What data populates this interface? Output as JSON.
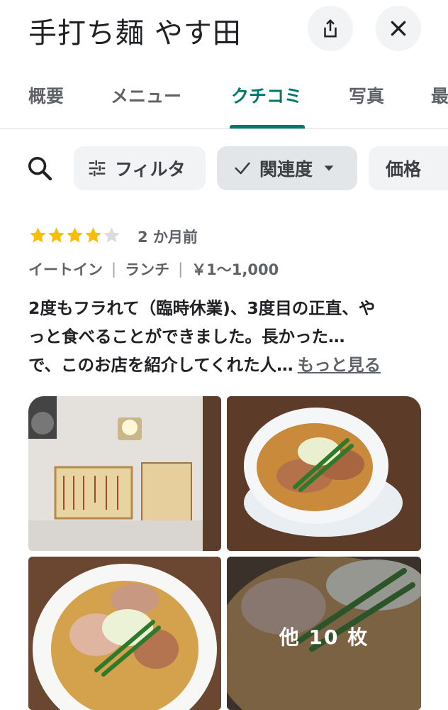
{
  "header": {
    "title": "手打ち麺 やす田",
    "share_icon": "share-icon",
    "close_icon": "close-icon"
  },
  "tabs": [
    {
      "label": "概要",
      "active": false
    },
    {
      "label": "メニュー",
      "active": false
    },
    {
      "label": "クチコミ",
      "active": true
    },
    {
      "label": "写真",
      "active": false
    },
    {
      "label": "最",
      "active": false
    }
  ],
  "toolbar": {
    "search_icon": "search-icon",
    "filter_label": "フィルタ",
    "sort_label": "関連度",
    "price_label": "価格"
  },
  "review": {
    "rating": 4,
    "max_rating": 5,
    "date": "2 か月前",
    "meta": [
      "イートイン",
      "ランチ",
      "￥1～1,000"
    ],
    "text_lines": [
      "2度もフラれて（臨時休業)、3度目の正直、や",
      "っと食べることができました。長かった…",
      "で、このお店を紹介してくれた人…"
    ],
    "more_label": "もっと見る",
    "photos_more_label": "他 10 枚"
  },
  "colors": {
    "accent": "#00796b",
    "star": "#fbbc04",
    "star_empty": "#dadce0"
  }
}
